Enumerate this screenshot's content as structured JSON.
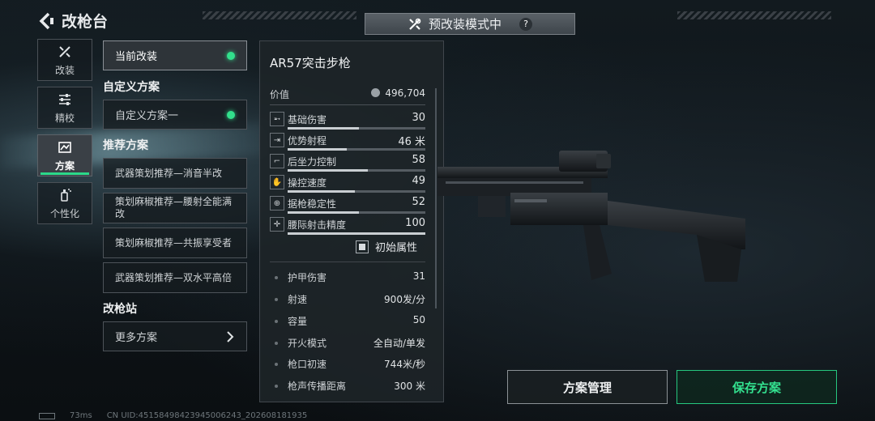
{
  "header": {
    "title": "改枪台"
  },
  "mode_banner": {
    "label": "预改装模式中",
    "help": "?"
  },
  "rail": [
    {
      "label": "改装",
      "icon": "wrench-icon"
    },
    {
      "label": "精校",
      "icon": "sliders-icon"
    },
    {
      "label": "方案",
      "icon": "blueprint-icon"
    },
    {
      "label": "个性化",
      "icon": "spray-icon"
    }
  ],
  "plans": {
    "current": "当前改装",
    "custom_section": "自定义方案",
    "custom_item": "自定义方案一",
    "recommended_section": "推荐方案",
    "recommended": [
      "武器策划推荐—消音半改",
      "策划麻椒推荐—腰射全能满改",
      "策划麻椒推荐—共振享受者",
      "武器策划推荐—双水平高倍"
    ],
    "station_section": "改枪站",
    "more": "更多方案"
  },
  "panel": {
    "weapon_name": "AR57突击步枪",
    "value_label": "价值",
    "value": "496,704",
    "stats": [
      {
        "label": "基础伤害",
        "value": "30",
        "fill": 0.52
      },
      {
        "label": "优势射程",
        "value": "46 米",
        "fill": 0.43
      },
      {
        "label": "后坐力控制",
        "value": "58",
        "fill": 0.58
      },
      {
        "label": "操控速度",
        "value": "49",
        "fill": 0.49
      },
      {
        "label": "据枪稳定性",
        "value": "52",
        "fill": 0.52
      },
      {
        "label": "腰际射击精度",
        "value": "100",
        "fill": 1.0
      }
    ],
    "base_attr": "初始属性",
    "attributes": [
      {
        "label": "护甲伤害",
        "value": "31"
      },
      {
        "label": "射速",
        "value": "900发/分"
      },
      {
        "label": "容量",
        "value": "50"
      },
      {
        "label": "开火模式",
        "value": "全自动/单发"
      },
      {
        "label": "枪口初速",
        "value": "744米/秒"
      },
      {
        "label": "枪声传播距离",
        "value": "300 米"
      }
    ]
  },
  "buttons": {
    "manage": "方案管理",
    "save": "保存方案"
  },
  "footer": {
    "ping": "73ms",
    "uid": "CN UID:4515849842394500624​3_202608181935"
  },
  "colors": {
    "accent": "#33e08f",
    "panel": "#1e2428"
  }
}
